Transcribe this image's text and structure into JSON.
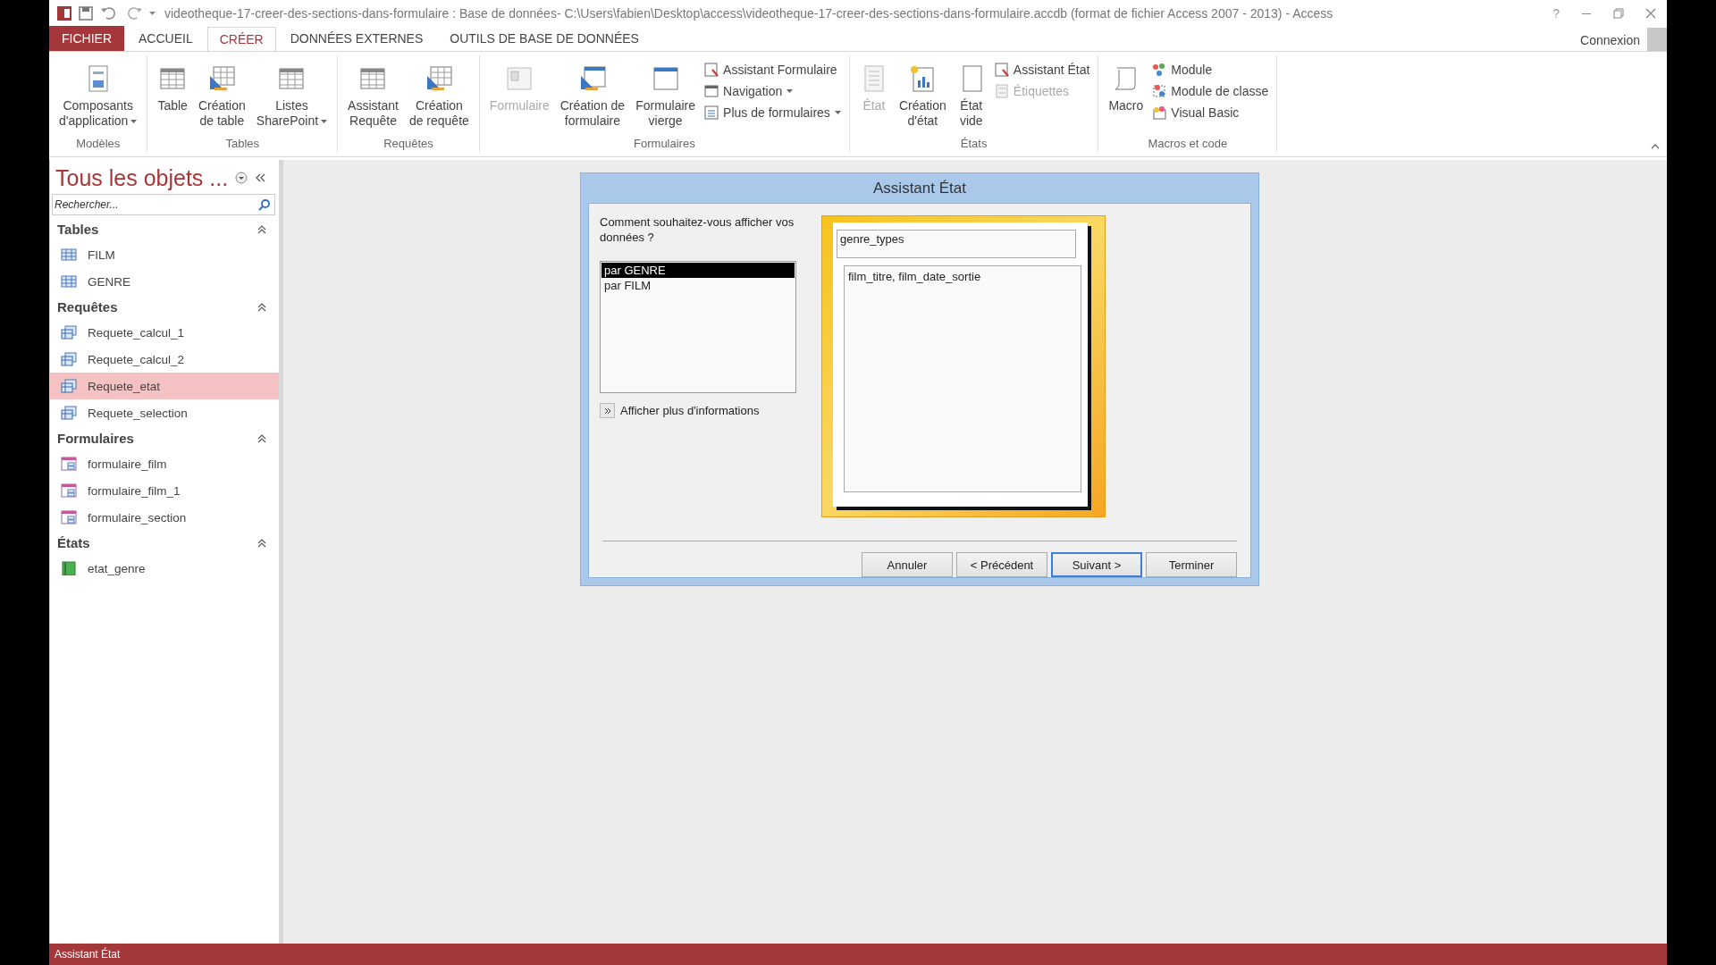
{
  "window": {
    "title": "videotheque-17-creer-des-sections-dans-formulaire : Base de données- C:\\Users\\fabien\\Desktop\\access\\videotheque-17-creer-des-sections-dans-formulaire.accdb (format de fichier Access 2007 - 2013) - Access",
    "help": "?"
  },
  "tabs": [
    {
      "label": "FICHIER",
      "kind": "file",
      "selected": false
    },
    {
      "label": "ACCUEIL",
      "kind": "tab",
      "selected": false
    },
    {
      "label": "CRÉER",
      "kind": "tab",
      "selected": true
    },
    {
      "label": "DONNÉES EXTERNES",
      "kind": "tab",
      "selected": false
    },
    {
      "label": "OUTILS DE BASE DE DONNÉES",
      "kind": "tab",
      "selected": false
    }
  ],
  "account": {
    "label": "Connexion"
  },
  "ribbon": {
    "groups": [
      {
        "label": "Modèles",
        "items": [
          {
            "label": "Composants\nd'application",
            "kind": "large",
            "disabled": false,
            "dropdown": true
          }
        ]
      },
      {
        "label": "Tables",
        "items": [
          {
            "label": "Table",
            "kind": "large",
            "disabled": false,
            "dropdown": false
          },
          {
            "label": "Création\nde table",
            "kind": "large",
            "disabled": false,
            "dropdown": false
          },
          {
            "label": "Listes\nSharePoint",
            "kind": "large",
            "disabled": false,
            "dropdown": true
          }
        ]
      },
      {
        "label": "Requêtes",
        "items": [
          {
            "label": "Assistant\nRequête",
            "kind": "large",
            "disabled": false,
            "dropdown": false
          },
          {
            "label": "Création\nde requête",
            "kind": "large",
            "disabled": false,
            "dropdown": false
          }
        ]
      },
      {
        "label": "Formulaires",
        "items": [
          {
            "label": "Formulaire",
            "kind": "large",
            "disabled": true,
            "dropdown": false
          },
          {
            "label": "Création de\nformulaire",
            "kind": "large",
            "disabled": false,
            "dropdown": false
          },
          {
            "label": "Formulaire\nvierge",
            "kind": "large",
            "disabled": false,
            "dropdown": false
          },
          {
            "label": "Assistant Formulaire",
            "kind": "small",
            "disabled": false,
            "dropdown": false
          },
          {
            "label": "Navigation",
            "kind": "small",
            "disabled": false,
            "dropdown": true
          },
          {
            "label": "Plus de formulaires",
            "kind": "small",
            "disabled": false,
            "dropdown": true
          }
        ]
      },
      {
        "label": "États",
        "items": [
          {
            "label": "État",
            "kind": "large",
            "disabled": true,
            "dropdown": false
          },
          {
            "label": "Création\nd'état",
            "kind": "large",
            "disabled": false,
            "dropdown": false
          },
          {
            "label": "État\nvide",
            "kind": "large",
            "disabled": false,
            "dropdown": false
          },
          {
            "label": "Assistant État",
            "kind": "small",
            "disabled": false,
            "dropdown": false
          },
          {
            "label": "Étiquettes",
            "kind": "small",
            "disabled": true,
            "dropdown": false
          }
        ]
      },
      {
        "label": "Macros et code",
        "items": [
          {
            "label": "Macro",
            "kind": "large",
            "disabled": false,
            "dropdown": false
          },
          {
            "label": "Module",
            "kind": "small",
            "disabled": false,
            "dropdown": false
          },
          {
            "label": "Module de classe",
            "kind": "small",
            "disabled": false,
            "dropdown": false
          },
          {
            "label": "Visual Basic",
            "kind": "small",
            "disabled": false,
            "dropdown": false
          }
        ]
      }
    ]
  },
  "navigation": {
    "title": "Tous les objets ...",
    "search": {
      "placeholder": "Rechercher..."
    },
    "groups": [
      {
        "label": "Tables",
        "items": [
          {
            "label": "FILM",
            "kind": "table",
            "selected": false
          },
          {
            "label": "GENRE",
            "kind": "table",
            "selected": false
          }
        ]
      },
      {
        "label": "Requêtes",
        "items": [
          {
            "label": "Requete_calcul_1",
            "kind": "query",
            "selected": false
          },
          {
            "label": "Requete_calcul_2",
            "kind": "query",
            "selected": false
          },
          {
            "label": "Requete_etat",
            "kind": "query",
            "selected": true
          },
          {
            "label": "Requete_selection",
            "kind": "query",
            "selected": false
          }
        ]
      },
      {
        "label": "Formulaires",
        "items": [
          {
            "label": "formulaire_film",
            "kind": "form",
            "selected": false
          },
          {
            "label": "formulaire_film_1",
            "kind": "form",
            "selected": false
          },
          {
            "label": "formulaire_section",
            "kind": "form",
            "selected": false
          }
        ]
      },
      {
        "label": "États",
        "items": [
          {
            "label": "etat_genre",
            "kind": "report",
            "selected": false
          }
        ]
      }
    ]
  },
  "dialog": {
    "title": "Assistant État",
    "prompt": "Comment souhaitez-vous afficher vos données ?",
    "options": [
      {
        "label": "par GENRE",
        "selected": true
      },
      {
        "label": "par FILM",
        "selected": false
      }
    ],
    "more_info": "Afficher plus d'informations",
    "preview": {
      "header": "genre_types",
      "detail": "film_titre, film_date_sortie"
    },
    "buttons": [
      {
        "label": "Annuler",
        "focused": false
      },
      {
        "label": "< Précédent",
        "focused": false
      },
      {
        "label": "Suivant >",
        "focused": true
      },
      {
        "label": "Terminer",
        "focused": false
      }
    ]
  },
  "status_bar": {
    "text": "Assistant État"
  }
}
